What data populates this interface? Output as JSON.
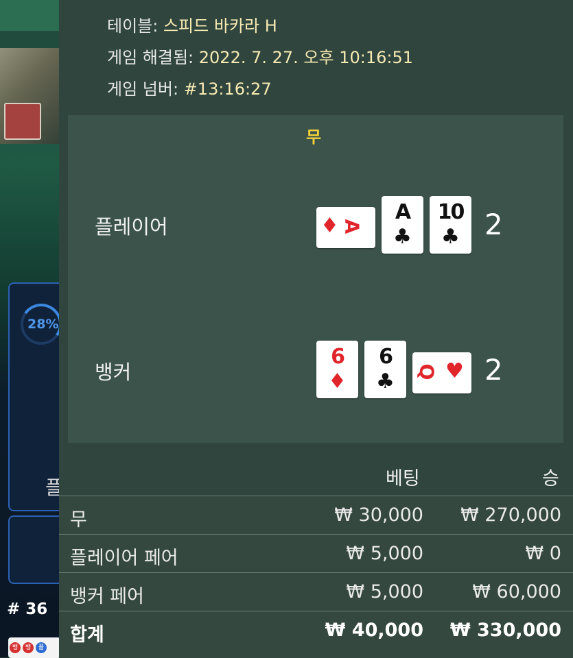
{
  "game_info": {
    "table_label": "테이블:",
    "table_value": "스피드 바카라 H",
    "resolved_label": "게임 해결됨:",
    "resolved_value": "2022. 7. 27. 오후 10:16:51",
    "number_label": "게임 넘버:",
    "number_value": "#13:16:27"
  },
  "result": {
    "outcome": "무",
    "outcome_color": "#f5d33a",
    "player": {
      "label": "플레이어",
      "score": "2",
      "cards": [
        {
          "rank": "A",
          "suit": "♦",
          "color": "red",
          "orientation": "horizontal"
        },
        {
          "rank": "A",
          "suit": "♣",
          "color": "black",
          "orientation": "vertical"
        },
        {
          "rank": "10",
          "suit": "♣",
          "color": "black",
          "orientation": "vertical"
        }
      ]
    },
    "banker": {
      "label": "뱅커",
      "score": "2",
      "cards": [
        {
          "rank": "6",
          "suit": "♦",
          "color": "red",
          "orientation": "vertical"
        },
        {
          "rank": "6",
          "suit": "♣",
          "color": "black",
          "orientation": "vertical"
        },
        {
          "rank": "Q",
          "suit": "♥",
          "color": "red",
          "orientation": "horizontal"
        }
      ]
    }
  },
  "bets": {
    "col_bet": "베팅",
    "col_win": "승",
    "rows": [
      {
        "label": "무",
        "bet": "₩ 30,000",
        "win": "₩ 270,000"
      },
      {
        "label": "플레이어 페어",
        "bet": "₩ 5,000",
        "win": "₩ 0"
      },
      {
        "label": "뱅커 페어",
        "bet": "₩ 5,000",
        "win": "₩ 60,000"
      }
    ],
    "total": {
      "label": "합계",
      "bet": "₩ 40,000",
      "win": "₩ 330,000"
    }
  },
  "background": {
    "progress": "28%",
    "side_label": "플",
    "round_number": "# 36",
    "road_chips": [
      "뱅",
      "뱅",
      "플"
    ]
  }
}
